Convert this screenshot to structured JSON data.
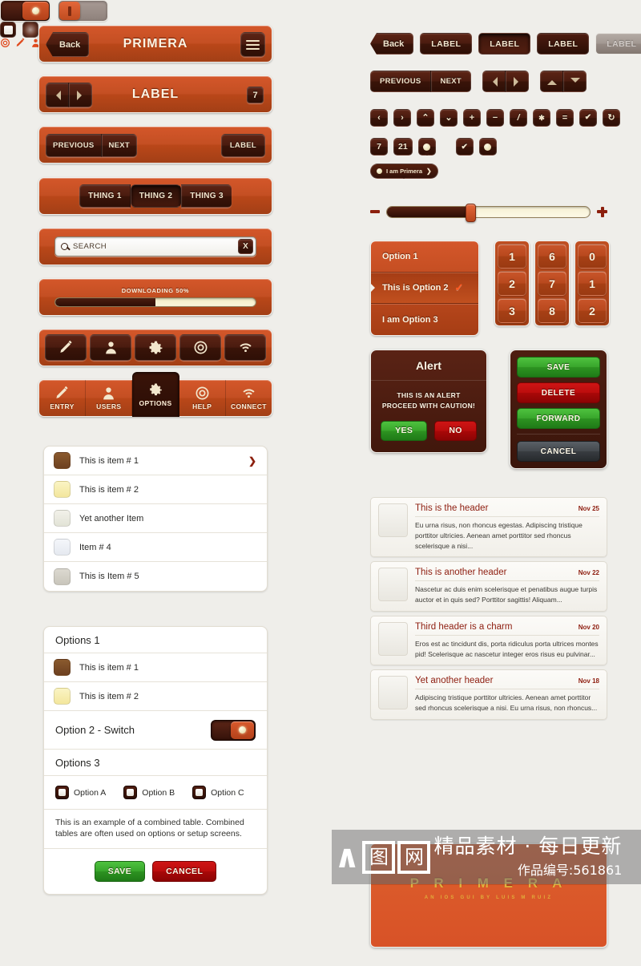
{
  "theme": {
    "background": "#efeeea",
    "orange": "#c44f23",
    "dark_brown": "#3a1409",
    "cream": "#f3e7cd",
    "accent_red": "#8f2012",
    "green": "#38a52b",
    "red": "#bb0d0d",
    "gold": "#e2b13c"
  },
  "left": {
    "navbar1": {
      "back_label": "Back",
      "title": "PRIMERA",
      "menu_icon": "hamburger-icon"
    },
    "navbar2": {
      "prev_icon": "triangle-left-icon",
      "next_icon": "triangle-right-icon",
      "title": "LABEL",
      "badge": "7"
    },
    "navbar3": {
      "previous": "PREVIOUS",
      "next": "NEXT",
      "right_label": "LABEL"
    },
    "tabbar": {
      "tabs": [
        {
          "label": "THING 1",
          "selected": false
        },
        {
          "label": "THING 2",
          "selected": true
        },
        {
          "label": "THING 3",
          "selected": false
        }
      ]
    },
    "searchbar": {
      "search_icon": "search-icon",
      "value": "SEARCH",
      "placeholder": "SEARCH",
      "clear_label": "X"
    },
    "progress": {
      "title": "DOWNLOADING 50%",
      "percent": 50
    },
    "iconbar": {
      "icons": [
        "pencil-icon",
        "user-icon",
        "gear-icon",
        "lifebuoy-icon",
        "wifi-icon"
      ]
    },
    "tabicons": {
      "items": [
        {
          "label": "ENTRY",
          "icon": "pencil-icon",
          "selected": false
        },
        {
          "label": "USERS",
          "icon": "user-icon",
          "selected": false
        },
        {
          "label": "OPTIONS",
          "icon": "gear-icon",
          "selected": true
        },
        {
          "label": "HELP",
          "icon": "lifebuoy-icon",
          "selected": false
        },
        {
          "label": "CONNECT",
          "icon": "wifi-icon",
          "selected": false
        }
      ]
    },
    "list1": {
      "rows": [
        {
          "text": "This is item # 1",
          "thumb": "#7b4a26",
          "chevron": "❯"
        },
        {
          "text": "This is item # 2",
          "thumb": "#f7eeb0",
          "chevron": ""
        },
        {
          "text": "Yet another Item",
          "thumb": "#e8e7de",
          "chevron": ""
        },
        {
          "text": "Item # 4",
          "thumb": "#eceef2",
          "chevron": ""
        },
        {
          "text": "This is Item # 5",
          "thumb": "#d3d0c7",
          "chevron": ""
        }
      ]
    },
    "list2": {
      "section1_title": "Options 1",
      "rows": [
        {
          "text": "This is item # 1",
          "thumb": "#7b4a26"
        },
        {
          "text": "This is item # 2",
          "thumb": "#f7eeb0"
        }
      ],
      "switch_label": "Option 2 - Switch",
      "switch_on": true,
      "section3_title": "Options 3",
      "checkboxes": [
        {
          "label": "Option A"
        },
        {
          "label": "Option B"
        },
        {
          "label": "Option C"
        }
      ],
      "note": "This is an example of a combined table. Combined tables are often used on options or setup screens.",
      "save_label": "SAVE",
      "cancel_label": "CANCEL"
    }
  },
  "right": {
    "button_row": {
      "back_label": "Back",
      "labels": [
        "LABEL",
        "LABEL",
        "LABEL",
        "LABEL"
      ],
      "states": [
        "normal",
        "pressed",
        "dark",
        "disabled"
      ]
    },
    "segments": {
      "previous": "PREVIOUS",
      "next": "NEXT",
      "arrows_lr": [
        "triangle-left-icon",
        "triangle-right-icon"
      ],
      "arrows_ud": [
        "triangle-up-icon",
        "triangle-down-icon"
      ]
    },
    "icon_buttons": [
      {
        "name": "chevron-left-icon",
        "glyph": "‹"
      },
      {
        "name": "chevron-right-icon",
        "glyph": "›"
      },
      {
        "name": "chevron-up-icon",
        "glyph": "⌃"
      },
      {
        "name": "chevron-down-icon",
        "glyph": "⌄"
      },
      {
        "name": "plus-icon",
        "glyph": "+"
      },
      {
        "name": "minus-icon",
        "glyph": "−"
      },
      {
        "name": "slash-icon",
        "glyph": "/"
      },
      {
        "name": "asterisk-icon",
        "glyph": "✱"
      },
      {
        "name": "equals-icon",
        "glyph": "="
      },
      {
        "name": "check-icon",
        "glyph": "✔"
      },
      {
        "name": "refresh-icon",
        "glyph": "↻"
      }
    ],
    "badges": [
      {
        "name": "badge-7",
        "value": "7"
      },
      {
        "name": "badge-21",
        "value": "21"
      },
      {
        "name": "pin-dot",
        "value": ""
      },
      {
        "name": "check-square",
        "value": "✔"
      },
      {
        "name": "dot-square",
        "value": ""
      }
    ],
    "toggles": [
      {
        "name": "toggle-on",
        "state": "on"
      },
      {
        "name": "toggle-off",
        "state": "off"
      }
    ],
    "popover": {
      "label": "I am Primera",
      "arrow": "❯"
    },
    "squares": [
      "white-square",
      "glow-square"
    ],
    "small_icons": [
      "lifebuoy-icon",
      "pencil-icon",
      "user-icon",
      "gear-icon",
      "search-icon",
      "refresh-icon",
      "chat-icon",
      "wifi-icon"
    ],
    "slider": {
      "minus": "−",
      "plus": "+",
      "value": 41
    },
    "option_list": [
      {
        "label": "Option 1",
        "selected": false,
        "check": ""
      },
      {
        "label": "This is Option 2",
        "selected": true,
        "check": "✓"
      },
      {
        "label": "I am Option 3",
        "selected": false,
        "check": ""
      }
    ],
    "numpads": [
      [
        "1",
        "2",
        "3"
      ],
      [
        "6",
        "7",
        "8"
      ],
      [
        "0",
        "1",
        "2"
      ]
    ],
    "alert": {
      "title": "Alert",
      "line1": "THIS IS AN ALERT",
      "line2": "PROCEED WITH CAUTION!",
      "yes_label": "YES",
      "no_label": "NO"
    },
    "action_sheet": {
      "buttons": [
        {
          "label": "SAVE",
          "style": "green"
        },
        {
          "label": "DELETE",
          "style": "red"
        },
        {
          "label": "FORWARD",
          "style": "green"
        }
      ],
      "cancel": {
        "label": "CANCEL",
        "style": "gray"
      }
    },
    "news": [
      {
        "header": "This is the header",
        "date": "Nov 25",
        "body": "Eu urna risus, non rhoncus egestas. Adipiscing tristique porttitor ultricies. Aenean amet porttitor sed rhoncus scelerisque a nisi..."
      },
      {
        "header": "This is another header",
        "date": "Nov 22",
        "body": "Nascetur ac duis enim scelerisque et penatibus augue turpis auctor et in quis sed? Porttitor sagittis! Aliquam..."
      },
      {
        "header": "Third header is a charm",
        "date": "Nov 20",
        "body": "Eros est ac tincidunt dis, porta ridiculus porta ultrices montes pid! Scelerisque ac nascetur integer eros risus eu pulvinar..."
      },
      {
        "header": "Yet another header",
        "date": "Nov 18",
        "body": "Adipiscing tristique porttitor ultricies. Aenean amet porttitor sed rhoncus scelerisque a nisi. Eu urna risus, non rhoncus..."
      }
    ],
    "logo": {
      "name": "P R I M E R A",
      "subtitle": "AN IOS GUI BY LUIS M RUIZ"
    }
  },
  "watermark": {
    "logo_char1": "图",
    "logo_char2": "网",
    "tagline": "精品素材 · 每日更新",
    "work_id": "作品编号:561861"
  }
}
